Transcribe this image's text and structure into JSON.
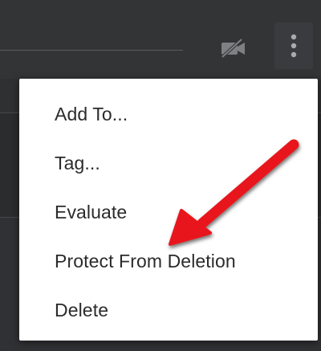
{
  "topbar": {
    "video_off_icon": "video-off-icon",
    "more_icon": "kebab-vertical-icon"
  },
  "menu": {
    "items": [
      {
        "label": "Add To..."
      },
      {
        "label": "Tag..."
      },
      {
        "label": "Evaluate"
      },
      {
        "label": "Protect From Deletion"
      },
      {
        "label": "Delete"
      }
    ]
  },
  "annotation": {
    "icon": "red-arrow-icon",
    "color": "#e8141b",
    "points_to": "Protect From Deletion"
  },
  "colors": {
    "chrome_bg": "#333436",
    "menu_bg": "#ffffff",
    "menu_text": "#2b2b2b",
    "icon_gray": "#9a9ca0"
  }
}
